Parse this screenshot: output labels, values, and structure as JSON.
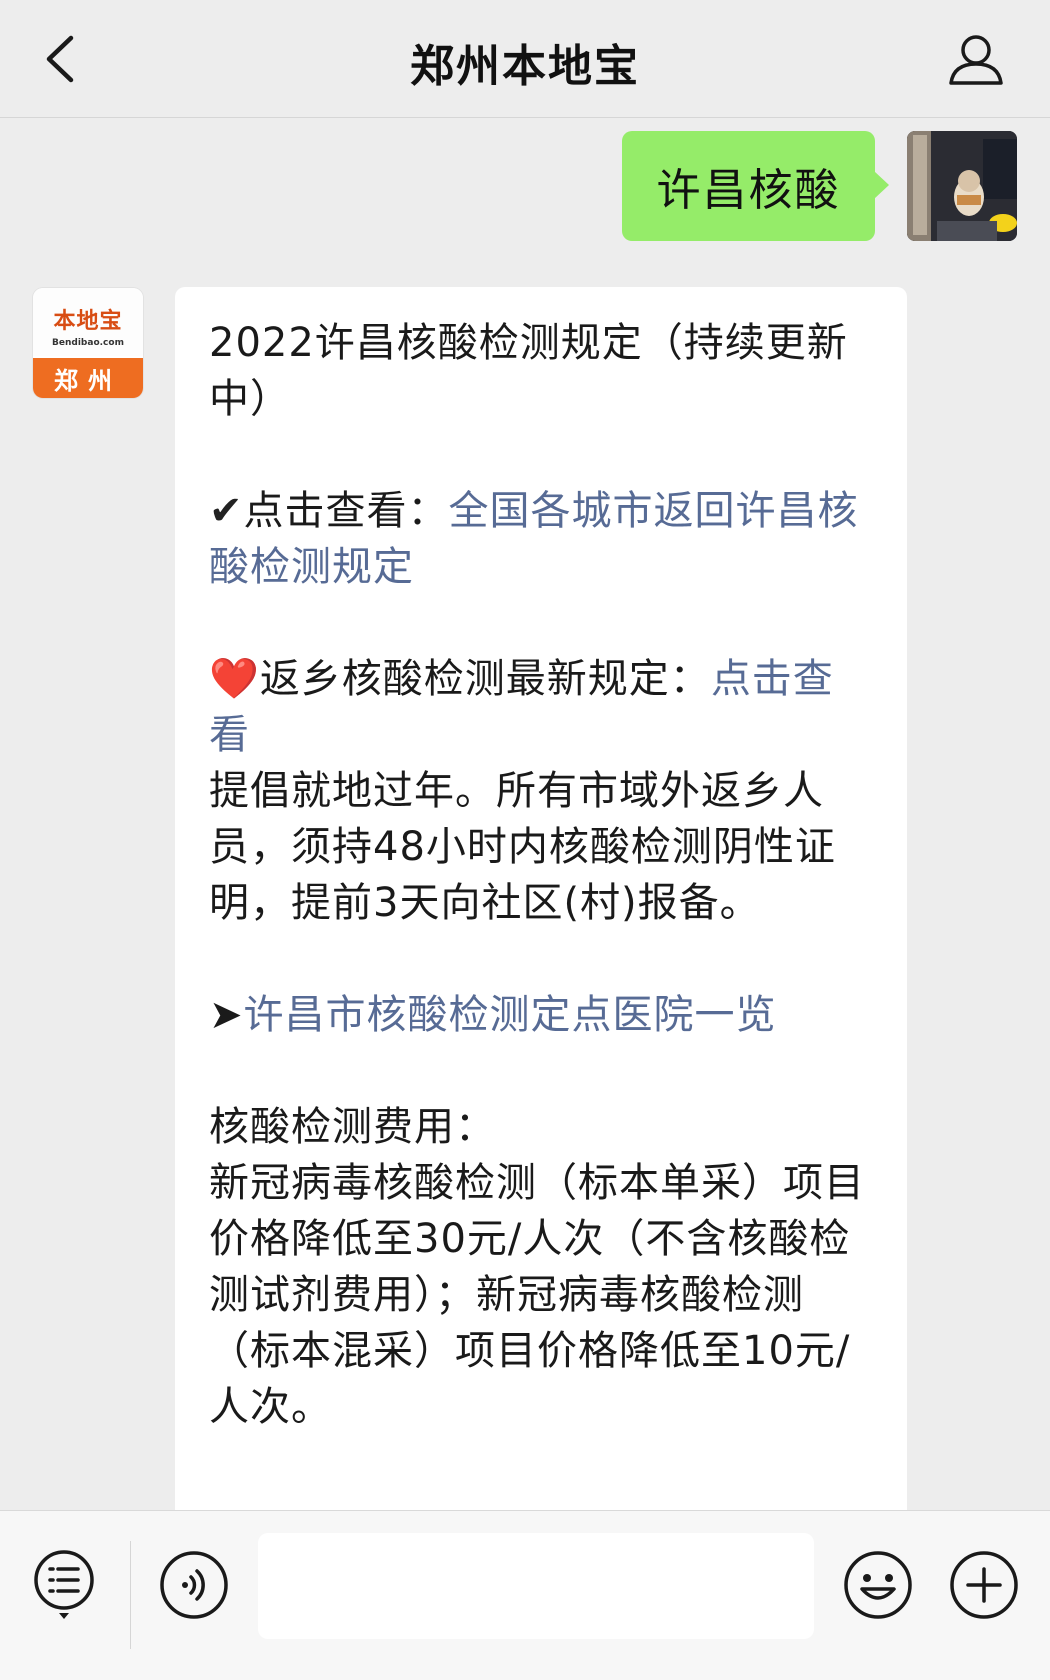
{
  "header": {
    "title": "郑州本地宝",
    "back_icon": "chevron-left-icon",
    "profile_icon": "person-icon"
  },
  "sent_message": {
    "text": "许昌核酸"
  },
  "bot": {
    "logo_text": "本地宝",
    "logo_domain": "Bendibao.com",
    "logo_city": "郑州"
  },
  "received_message": {
    "title": "2022许昌核酸检测规定（持续更新中）",
    "item1_mark": "✔",
    "item1_label": "点击查看：",
    "item1_link": "全国各城市返回许昌核酸检测规定",
    "item2_mark": "❤️",
    "item2_label": "返乡核酸检测最新规定：",
    "item2_link": "点击查看",
    "notice": "提倡就地过年。所有市域外返乡人员，须持48小时内核酸检测阴性证明，提前3天向社区(村)报备。",
    "item3_mark": "➤",
    "item3_link": "许昌市核酸检测定点医院一览",
    "fee_title": "核酸检测费用：",
    "fee_text": "新冠病毒核酸检测（标本单采）项目价格降低至30元/人次（不含核酸检测试剂费用）；新冠病毒核酸检测（标本混采）项目价格降低至10元/人次。"
  },
  "bottom_bar": {
    "menu_icon": "menu-list-icon",
    "voice_icon": "voice-icon",
    "emoji_icon": "emoji-icon",
    "plus_icon": "plus-icon",
    "input_value": ""
  },
  "colors": {
    "sent_bubble": "#95ec69",
    "link": "#576b95",
    "background": "#ededed",
    "logo_orange": "#ee6d21"
  }
}
